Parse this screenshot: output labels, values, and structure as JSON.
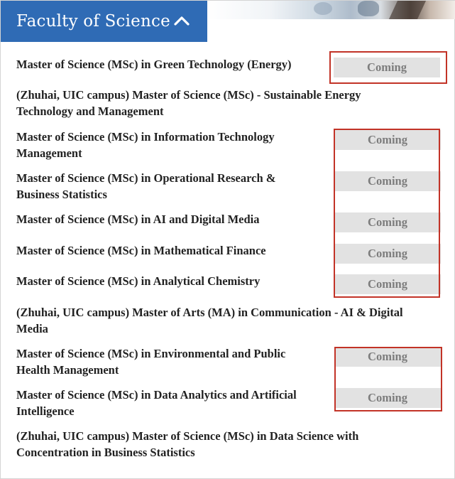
{
  "header": {
    "title": "Faculty of Science",
    "toggle_icon": "chevron-up-icon"
  },
  "colors": {
    "header_bg": "#2f6bb5",
    "badge_bg": "#e2e2e2",
    "badge_text": "#7d7d7d",
    "highlight_border": "#c23327"
  },
  "programmes": [
    {
      "name": "Master of Science (MSc) in Green Technology (Energy)",
      "status": "Coming"
    },
    {
      "name": "(Zhuhai, UIC campus) Master of Science (MSc) - Sustainable Energy Technology and Management",
      "status": ""
    },
    {
      "name": "Master of Science (MSc) in Information Technology Management",
      "status": "Coming"
    },
    {
      "name": "Master of Science (MSc) in Operational Research & Business Statistics",
      "status": "Coming"
    },
    {
      "name": "Master of Science (MSc) in AI and Digital Media",
      "status": "Coming"
    },
    {
      "name": "Master of Science (MSc) in Mathematical Finance",
      "status": "Coming"
    },
    {
      "name": "Master of Science (MSc) in Analytical Chemistry",
      "status": "Coming"
    },
    {
      "name": "(Zhuhai, UIC campus) Master of Arts (MA) in Communication - AI & Digital Media",
      "status": ""
    },
    {
      "name": "Master of Science (MSc) in Environmental and Public Health Management",
      "status": "Coming"
    },
    {
      "name": "Master of Science (MSc) in Data Analytics and Artificial Intelligence",
      "status": "Coming"
    },
    {
      "name": "(Zhuhai, UIC campus) Master of Science (MSc) in Data Science with Concentration in Business Statistics",
      "status": ""
    }
  ]
}
